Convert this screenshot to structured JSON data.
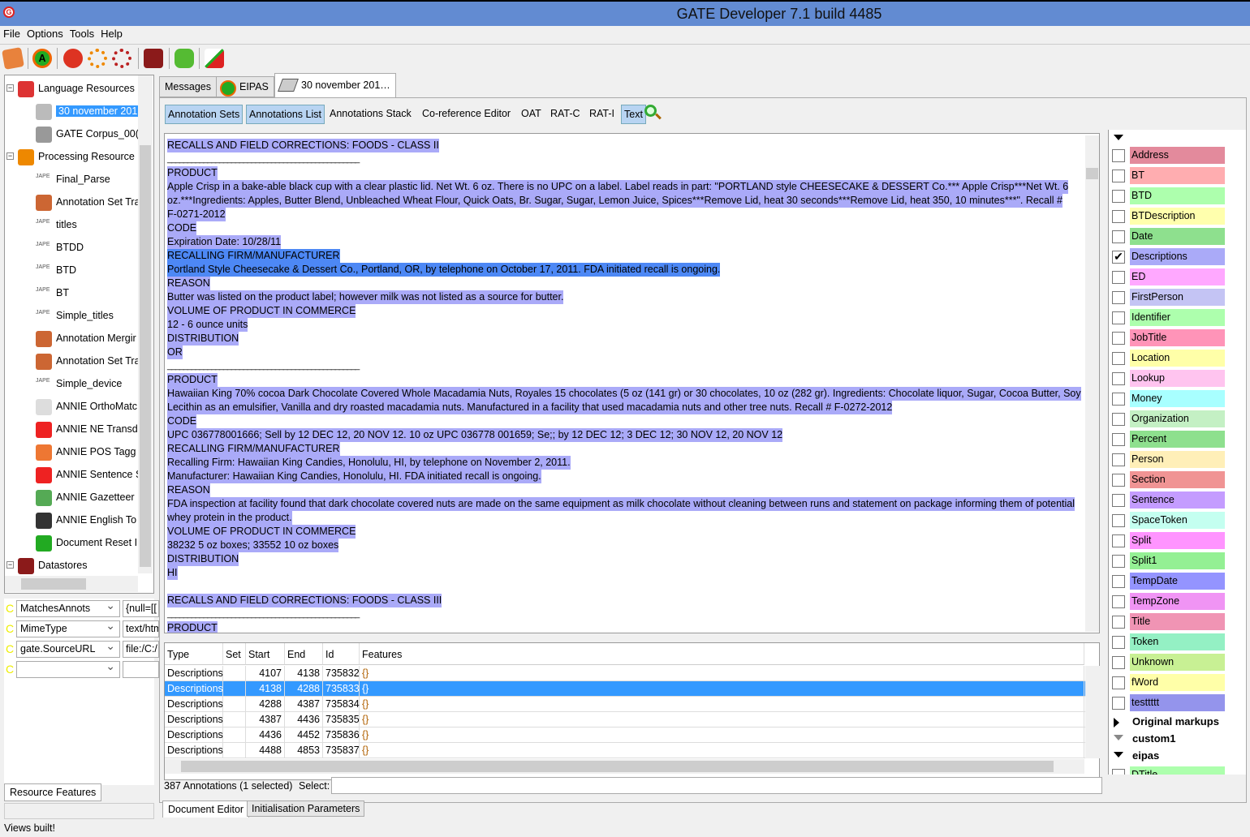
{
  "window": {
    "title": "GATE Developer 7.1 build 4485"
  },
  "menu": [
    "File",
    "Options",
    "Tools",
    "Help"
  ],
  "toolbar": [
    "load-document-icon",
    "annie-icon",
    "language-resource-icon",
    "processing-resource-icon",
    "application-icon",
    "datastore-icon",
    "plugin-manager-icon",
    "annotation-diff-icon"
  ],
  "tree": {
    "items": [
      {
        "label": "Language Resources",
        "level": 0,
        "icon": "language-resources-icon"
      },
      {
        "label": "30 november 201",
        "level": 1,
        "icon": "document-icon",
        "selected": true
      },
      {
        "label": "GATE Corpus_00(",
        "level": 1,
        "icon": "corpus-icon"
      },
      {
        "label": "Processing Resource",
        "level": 0,
        "icon": "processing-resources-icon"
      },
      {
        "label": "Final_Parse",
        "level": 1,
        "icon": "jape-icon"
      },
      {
        "label": "Annotation Set Tra",
        "level": 1,
        "icon": "transfer-icon"
      },
      {
        "label": "titles",
        "level": 1,
        "icon": "jape-icon"
      },
      {
        "label": "BTDD",
        "level": 1,
        "icon": "jape-icon"
      },
      {
        "label": "BTD",
        "level": 1,
        "icon": "jape-icon"
      },
      {
        "label": "BT",
        "level": 1,
        "icon": "jape-icon"
      },
      {
        "label": "Simple_titles",
        "level": 1,
        "icon": "jape-icon"
      },
      {
        "label": "Annotation Mergir",
        "level": 1,
        "icon": "transfer-icon"
      },
      {
        "label": "Annotation Set Tra",
        "level": 1,
        "icon": "transfer-icon"
      },
      {
        "label": "Simple_device",
        "level": 1,
        "icon": "jape-icon"
      },
      {
        "label": "ANNIE OrthoMatc",
        "level": 1,
        "icon": "orthomatcher-icon"
      },
      {
        "label": "ANNIE NE Transd",
        "level": 1,
        "icon": "ne-transducer-icon"
      },
      {
        "label": "ANNIE POS Tagg",
        "level": 1,
        "icon": "pos-tagger-icon"
      },
      {
        "label": "ANNIE Sentence S",
        "level": 1,
        "icon": "sentence-splitter-icon"
      },
      {
        "label": "ANNIE Gazetteer",
        "level": 1,
        "icon": "gazetteer-icon"
      },
      {
        "label": "ANNIE English To",
        "level": 1,
        "icon": "tokeniser-icon"
      },
      {
        "label": "Document Reset I",
        "level": 1,
        "icon": "document-reset-icon"
      },
      {
        "label": "Datastores",
        "level": 0,
        "icon": "datastores-icon"
      }
    ]
  },
  "features": {
    "rows": [
      {
        "key": "MatchesAnnots",
        "value": "{null=[["
      },
      {
        "key": "MimeType",
        "value": "text/htm"
      },
      {
        "key": "gate.SourceURL",
        "value": "file:/C:/"
      },
      {
        "key": "",
        "value": ""
      }
    ],
    "tab": "Resource Features"
  },
  "status": "Views built!",
  "tabs": [
    {
      "label": "Messages"
    },
    {
      "label": "EIPAS"
    },
    {
      "label": "30 november 201…"
    }
  ],
  "view_buttons": [
    {
      "label": "Annotation Sets",
      "on": true
    },
    {
      "label": "Annotations List",
      "on": true
    },
    {
      "label": "Annotations Stack",
      "on": false
    },
    {
      "label": "Co-reference Editor",
      "on": false
    },
    {
      "label": "OAT",
      "on": false
    },
    {
      "label": "RAT-C",
      "on": false
    },
    {
      "label": "RAT-I",
      "on": false
    },
    {
      "label": "Text",
      "on": true
    }
  ],
  "document": {
    "lines": [
      {
        "t": "RECALLS AND FIELD CORRECTIONS: FOODS - CLASS II",
        "h": "hl"
      },
      {
        "t": "________________________________________________",
        "h": "none"
      },
      {
        "t": "PRODUCT",
        "h": "hl"
      },
      {
        "t": "Apple Crisp in a bake-able black cup with a clear plastic lid. Net Wt. 6 oz. There is no UPC on a label. Label reads in part: \"PORTLAND style CHEESECAKE & DESSERT Co.*** Apple Crisp***Net Wt. 6",
        "h": "hl"
      },
      {
        "t": "oz.***Ingredients: Apples, Butter Blend, Unbleached Wheat Flour, Quick Oats, Br. Sugar, Sugar, Lemon Juice, Spices***Remove Lid, heat 30 seconds***Remove Lid, heat 350, 10 minutes***\". Recall #",
        "h": "hl"
      },
      {
        "t": "F-0271-2012",
        "h": "hl"
      },
      {
        "t": "CODE",
        "h": "hl"
      },
      {
        "t": "Expiration Date: 10/28/11",
        "h": "hl"
      },
      {
        "t": "RECALLING FIRM/MANUFACTURER",
        "h": "hs"
      },
      {
        "t": "Portland Style Cheesecake & Dessert Co., Portland, OR, by telephone on October 17, 2011. FDA initiated recall is ongoing.",
        "h": "hs"
      },
      {
        "t": "REASON",
        "h": "hl"
      },
      {
        "t": "Butter was listed on the product label; however milk was not listed as a source for butter.",
        "h": "hl"
      },
      {
        "t": "VOLUME OF PRODUCT IN COMMERCE",
        "h": "hl"
      },
      {
        "t": "12 - 6 ounce units",
        "h": "hl"
      },
      {
        "t": "DISTRIBUTION",
        "h": "hl"
      },
      {
        "t": "OR",
        "h": "hl"
      },
      {
        "t": "________________________________________________",
        "h": "none"
      },
      {
        "t": "PRODUCT",
        "h": "hl"
      },
      {
        "t": "Hawaiian King 70% cocoa Dark Chocolate Covered Whole Macadamia Nuts, Royales 15 chocolates (5 oz (141 gr) or 30 chocolates, 10 oz (282 gr). Ingredients: Chocolate liquor, Sugar, Cocoa Butter, Soy",
        "h": "hl"
      },
      {
        "t": "Lecithin as an emulsifier, Vanilla and dry roasted macadamia nuts. Manufactured in a facility that used macadamia nuts and other tree nuts. Recall # F-0272-2012",
        "h": "hl"
      },
      {
        "t": "CODE",
        "h": "hl"
      },
      {
        "t": "UPC 036778001666; Sell by 12 DEC 12, 20 NOV 12. 10 oz UPC 036778 001659; Se;; by 12 DEC 12; 3 DEC 12; 30 NOV 12, 20 NOV 12",
        "h": "hl"
      },
      {
        "t": "RECALLING FIRM/MANUFACTURER",
        "h": "hl"
      },
      {
        "t": "Recalling Firm: Hawaiian King Candies, Honolulu, HI, by telephone on November 2, 2011.",
        "h": "hl"
      },
      {
        "t": "Manufacturer: Hawaiian King Candies, Honolulu, HI. FDA initiated recall is ongoing.",
        "h": "hl"
      },
      {
        "t": "REASON",
        "h": "hl"
      },
      {
        "t": "FDA inspection at facility found that dark chocolate covered nuts are made on the same equipment as milk chocolate without cleaning between runs and statement on package informing them of potential",
        "h": "hl"
      },
      {
        "t": "whey protein in the product.",
        "h": "hl"
      },
      {
        "t": "VOLUME OF PRODUCT IN COMMERCE",
        "h": "hl"
      },
      {
        "t": "38232 5 oz boxes; 33552 10 oz boxes",
        "h": "hl"
      },
      {
        "t": "DISTRIBUTION",
        "h": "hl"
      },
      {
        "t": "HI",
        "h": "hl"
      },
      {
        "t": "",
        "h": "none"
      },
      {
        "t": "RECALLS AND FIELD CORRECTIONS: FOODS - CLASS III",
        "h": "hl"
      },
      {
        "t": "________________________________________________",
        "h": "none"
      },
      {
        "t": "PRODUCT",
        "h": "hl"
      }
    ]
  },
  "annotation_types": [
    {
      "label": "Address",
      "color": "#e38a9c",
      "checked": false
    },
    {
      "label": "BT",
      "color": "#ffadb0",
      "checked": false
    },
    {
      "label": "BTD",
      "color": "#adffad",
      "checked": false
    },
    {
      "label": "BTDescription",
      "color": "#ffffad",
      "checked": false
    },
    {
      "label": "Date",
      "color": "#8ee08e",
      "checked": false
    },
    {
      "label": "Descriptions",
      "color": "#aaaaf8",
      "checked": true
    },
    {
      "label": "ED",
      "color": "#ffa8ff",
      "checked": false
    },
    {
      "label": "FirstPerson",
      "color": "#c4c4f4",
      "checked": false
    },
    {
      "label": "Identifier",
      "color": "#adffad",
      "checked": false
    },
    {
      "label": "JobTitle",
      "color": "#ff94b8",
      "checked": false
    },
    {
      "label": "Location",
      "color": "#ffffa8",
      "checked": false
    },
    {
      "label": "Lookup",
      "color": "#ffc4ef",
      "checked": false
    },
    {
      "label": "Money",
      "color": "#a8ffff",
      "checked": false
    },
    {
      "label": "Organization",
      "color": "#c4f0c4",
      "checked": false
    },
    {
      "label": "Percent",
      "color": "#8ee08e",
      "checked": false
    },
    {
      "label": "Person",
      "color": "#ffefb8",
      "checked": false
    },
    {
      "label": "Section",
      "color": "#f09494",
      "checked": false
    },
    {
      "label": "Sentence",
      "color": "#c49cff",
      "checked": false
    },
    {
      "label": "SpaceToken",
      "color": "#c4fff0",
      "checked": false
    },
    {
      "label": "Split",
      "color": "#ff94ff",
      "checked": false
    },
    {
      "label": "Split1",
      "color": "#94f094",
      "checked": false
    },
    {
      "label": "TempDate",
      "color": "#9494ff",
      "checked": false
    },
    {
      "label": "TempZone",
      "color": "#f094f4",
      "checked": false
    },
    {
      "label": "Title",
      "color": "#f094b4",
      "checked": false
    },
    {
      "label": "Token",
      "color": "#94f0c4",
      "checked": false
    },
    {
      "label": "Unknown",
      "color": "#c8f094",
      "checked": false
    },
    {
      "label": "fWord",
      "color": "#ffffa8",
      "checked": false
    },
    {
      "label": "testtttt",
      "color": "#9494ec",
      "checked": false
    }
  ],
  "annotation_groups": [
    {
      "label": "Original markups",
      "state": "collapsed"
    },
    {
      "label": "custom1",
      "state": "empty"
    },
    {
      "label": "eipas",
      "state": "expanded"
    }
  ],
  "eipas_first": {
    "label": "DTitle",
    "color": "#adffad"
  },
  "table": {
    "headers": [
      "Type",
      "Set",
      "Start",
      "End",
      "Id",
      "Features"
    ],
    "rows": [
      [
        "Descriptions",
        "",
        "4107",
        "4138",
        "735832",
        "{}"
      ],
      [
        "Descriptions",
        "",
        "4138",
        "4288",
        "735833",
        "{}"
      ],
      [
        "Descriptions",
        "",
        "4288",
        "4387",
        "735834",
        "{}"
      ],
      [
        "Descriptions",
        "",
        "4387",
        "4436",
        "735835",
        "{}"
      ],
      [
        "Descriptions",
        "",
        "4436",
        "4452",
        "735836",
        "{}"
      ],
      [
        "Descriptions",
        "",
        "4488",
        "4853",
        "735837",
        "{}"
      ]
    ],
    "selected_row": 1
  },
  "footer": {
    "count": "387 Annotations (1 selected)",
    "select_label": "Select:",
    "select_value": ""
  },
  "bottom_tabs": [
    "Document Editor",
    "Initialisation Parameters"
  ]
}
